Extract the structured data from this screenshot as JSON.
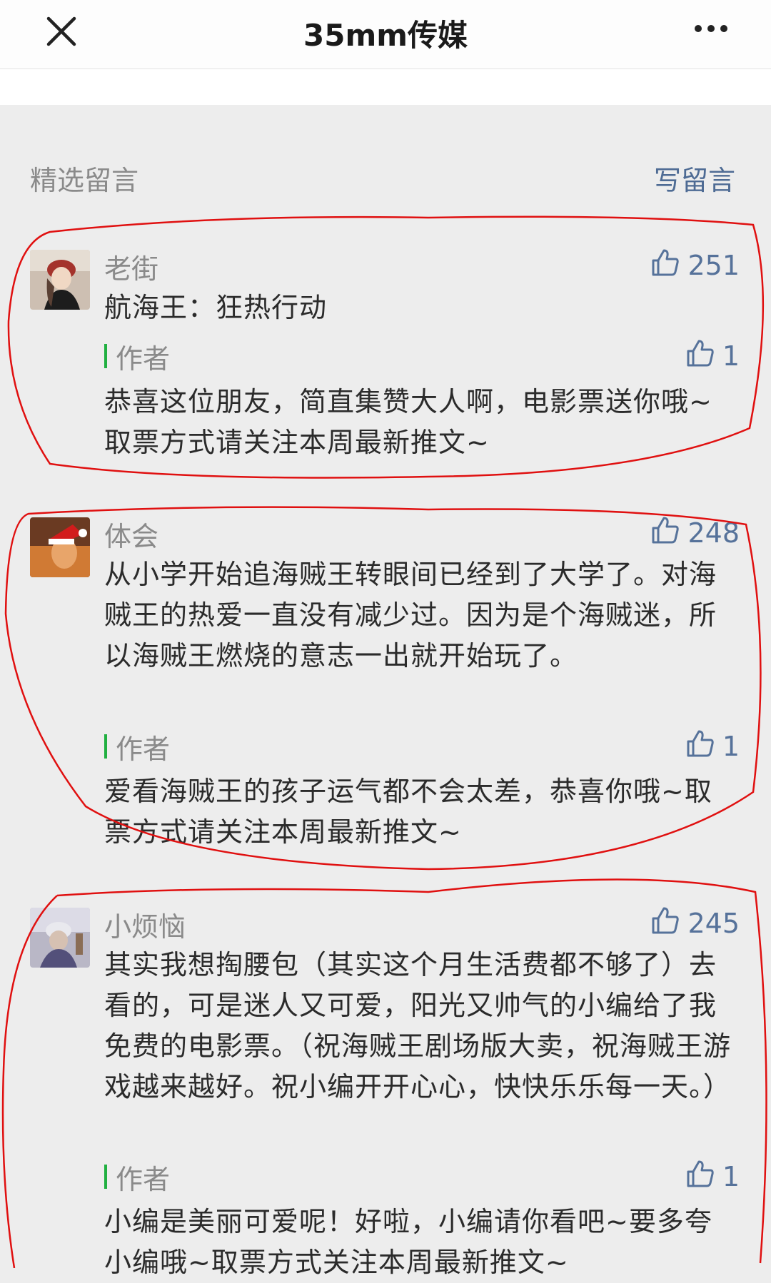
{
  "header": {
    "title": "35mm传媒",
    "close_icon": "close-icon",
    "more_icon": "more-icon"
  },
  "section": {
    "label": "精选留言",
    "write_label": "写留言"
  },
  "comments": [
    {
      "nickname": "老街",
      "likes": "251",
      "text": "航海王：狂热行动",
      "reply": {
        "label": "作者",
        "likes": "1",
        "text": "恭喜这位朋友，简直集赞大人啊，电影票送你哦~取票方式请关注本周最新推文~"
      }
    },
    {
      "nickname": "体会",
      "likes": "248",
      "text": "从小学开始追海贼王转眼间已经到了大学了。对海贼王的热爱一直没有减少过。因为是个海贼迷，所以海贼王燃烧的意志一出就开始玩了。",
      "reply": {
        "label": "作者",
        "likes": "1",
        "text": "爱看海贼王的孩子运气都不会太差，恭喜你哦~取票方式请关注本周最新推文~"
      }
    },
    {
      "nickname": "小烦恼",
      "likes": "245",
      "text": "其实我想掏腰包（其实这个月生活费都不够了）去看的，可是迷人又可爱，阳光又帅气的小编给了我免费的电影票。（祝海贼王剧场版大卖，祝海贼王游戏越来越好。祝小编开开心心，快快乐乐每一天。）",
      "reply": {
        "label": "作者",
        "likes": "1",
        "text": "小编是美丽可爱呢！好啦，小编请你看吧~要多夸小编哦~取票方式关注本周最新推文~"
      }
    }
  ],
  "colors": {
    "accent_link": "#56729a",
    "author_bar": "#21b041",
    "annotation": "#e01010"
  }
}
